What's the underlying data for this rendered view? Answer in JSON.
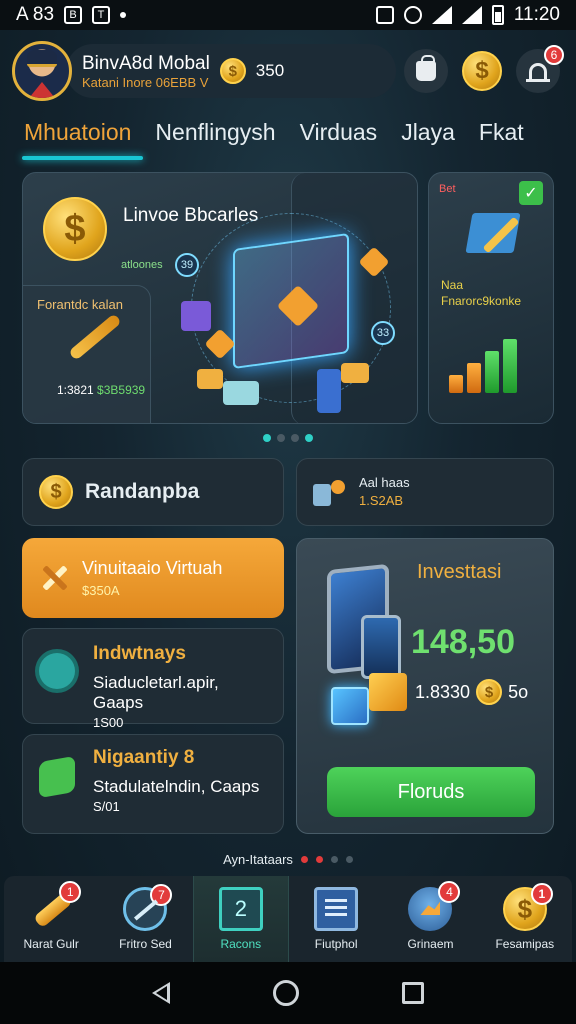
{
  "status_bar": {
    "left_text": "A 83",
    "time": "11:20"
  },
  "profile": {
    "name": "BinvA8d Mobal",
    "subtitle": "Katani Inore 06EBB V",
    "balance": "350",
    "coin_symbol": "$"
  },
  "header": {
    "badge_count": "6"
  },
  "tabs": [
    "Mhuatoion",
    "Nenflingysh",
    "Virduas",
    "Jlaya",
    "Fkat"
  ],
  "hero": {
    "title": "Linvoe Bbcarles",
    "subtitle": "atloones",
    "node_labels": [
      "39",
      "33"
    ],
    "caption": "Forantdc kalan",
    "stat_label": "1:3821",
    "stat_value": "$3B5939",
    "side_tag": "Bet",
    "side_label_1": "Naa",
    "side_label_2": "Fnarorc9konke"
  },
  "carousel_dots": 4,
  "cards": {
    "rand": {
      "title": "Randanpba",
      "coin": "$"
    },
    "stats": {
      "line1": "Aal haas",
      "line2": "1.S2AB"
    },
    "virtual": {
      "title": "Vinuitaaio Virtuah",
      "value": "$350A"
    },
    "indwtnays": {
      "title": "Indwtnays",
      "desc": "Siaducletarl.apir, Gaaps",
      "value": "1S00"
    },
    "higaantly": {
      "title": "Nigaantiy 8",
      "desc": "Stadulatelndin, Caaps",
      "value": "S/01"
    },
    "invest": {
      "title": "Investtasi",
      "amount": "148,50",
      "sub_value": "1.8330",
      "sub_suffix": "5o",
      "button": "Floruds"
    }
  },
  "footer_label": "Ayn-Itataars",
  "bottom_nav": [
    {
      "label": "Narat Gulr",
      "badge": "1",
      "icon": "hammer-icon"
    },
    {
      "label": "Fritro Sed",
      "badge": "7",
      "icon": "target-icon"
    },
    {
      "label": "Racons",
      "badge": "",
      "icon": "document-icon",
      "glyph": "2"
    },
    {
      "label": "Fiutphol",
      "badge": "",
      "icon": "list-icon"
    },
    {
      "label": "Grinaem",
      "badge": "4",
      "icon": "chart-icon"
    },
    {
      "label": "Fesamipas",
      "badge": "1",
      "icon": "coin-icon",
      "glyph": "$"
    }
  ],
  "colors": {
    "accent": "#f0a43a",
    "tab_underline": "#19c6d3",
    "positive": "#6fe06f",
    "button": "#3fbf4c"
  }
}
